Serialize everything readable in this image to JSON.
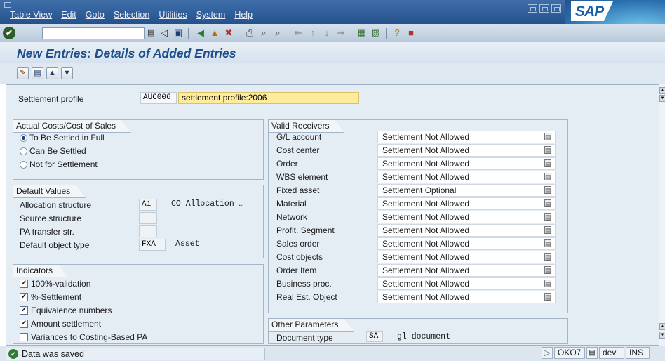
{
  "menu": {
    "items": [
      "Table View",
      "Edit",
      "Goto",
      "Selection",
      "Utilities",
      "System",
      "Help"
    ]
  },
  "logo": "SAP",
  "toolbar": {
    "ok_icon": "check-circle-icon",
    "command_value": "",
    "icons": [
      "back-icon",
      "save-icon",
      "exit-icon",
      "cancel-icon",
      "print-icon",
      "find-icon",
      "find-next-icon",
      "first-page-icon",
      "previous-page-icon",
      "next-page-icon",
      "last-page-icon",
      "create-session-icon",
      "shortcut-icon",
      "help-icon",
      "layout-icon"
    ]
  },
  "page": {
    "title": "New Entries: Details of Added Entries"
  },
  "app_toolbar": {
    "icons": [
      "display-change-icon",
      "save-icon",
      "previous-entry-icon",
      "next-entry-icon"
    ]
  },
  "header": {
    "label": "Settlement profile",
    "code": "AUC006",
    "description": "settlement profile:2006"
  },
  "actual_costs": {
    "title": "Actual Costs/Cost of Sales",
    "options": [
      {
        "label": "To Be Settled in Full",
        "selected": true
      },
      {
        "label": "Can Be Settled",
        "selected": false
      },
      {
        "label": "Not for Settlement",
        "selected": false
      }
    ]
  },
  "default_values": {
    "title": "Default Values",
    "rows": [
      {
        "label": "Allocation structure",
        "code": "A1",
        "text": "CO Allocation …"
      },
      {
        "label": "Source structure",
        "code": "",
        "text": ""
      },
      {
        "label": "PA transfer str.",
        "code": "",
        "text": ""
      },
      {
        "label": "Default object type",
        "code": "FXA",
        "text": "Asset"
      }
    ]
  },
  "indicators": {
    "title": "Indicators",
    "items": [
      {
        "label": "100%-validation",
        "checked": true
      },
      {
        "label": "%-Settlement",
        "checked": true
      },
      {
        "label": "Equivalence numbers",
        "checked": true
      },
      {
        "label": "Amount settlement",
        "checked": true
      },
      {
        "label": "Variances to Costing-Based PA",
        "checked": false
      }
    ]
  },
  "valid_receivers": {
    "title": "Valid Receivers",
    "rows": [
      {
        "name": "G/L account",
        "value": "Settlement Not Allowed"
      },
      {
        "name": "Cost center",
        "value": "Settlement Not Allowed"
      },
      {
        "name": "Order",
        "value": "Settlement Not Allowed"
      },
      {
        "name": "WBS element",
        "value": "Settlement Not Allowed"
      },
      {
        "name": "Fixed asset",
        "value": "Settlement Optional"
      },
      {
        "name": "Material",
        "value": "Settlement Not Allowed"
      },
      {
        "name": "Network",
        "value": "Settlement Not Allowed"
      },
      {
        "name": "Profit. Segment",
        "value": "Settlement Not Allowed"
      },
      {
        "name": "Sales order",
        "value": "Settlement Not Allowed"
      },
      {
        "name": "Cost objects",
        "value": "Settlement Not Allowed"
      },
      {
        "name": "Order Item",
        "value": "Settlement Not Allowed"
      },
      {
        "name": "Business proc.",
        "value": "Settlement Not Allowed"
      },
      {
        "name": "Real Est. Object",
        "value": "Settlement Not Allowed"
      }
    ]
  },
  "other_parameters": {
    "title": "Other Parameters",
    "label": "Document type",
    "code": "SA",
    "text": "gl document"
  },
  "status": {
    "message": "Data was saved",
    "transaction": "OKO7",
    "server": "dev",
    "mode": "INS"
  },
  "colors": {
    "menubar": "#25528c",
    "title": "#1f4e8a",
    "content_bg": "#e4ecf4",
    "highlight_field": "#ffeb9c"
  }
}
